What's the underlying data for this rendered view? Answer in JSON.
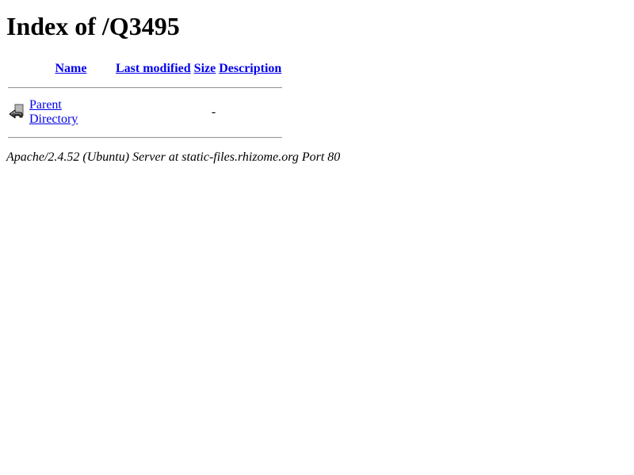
{
  "page": {
    "title": "Index of /Q3495"
  },
  "table": {
    "headers": {
      "name": "Name",
      "last_modified": "Last modified",
      "size": "Size",
      "description": "Description"
    },
    "rows": [
      {
        "icon": "back-arrow-icon",
        "name": "Parent Directory",
        "last_modified": "",
        "size": "-",
        "description": ""
      }
    ]
  },
  "footer": {
    "server_signature": "Apache/2.4.52 (Ubuntu) Server at static-files.rhizome.org Port 80"
  },
  "colors": {
    "link": "#0000ee",
    "text": "#000000",
    "background": "#ffffff"
  }
}
